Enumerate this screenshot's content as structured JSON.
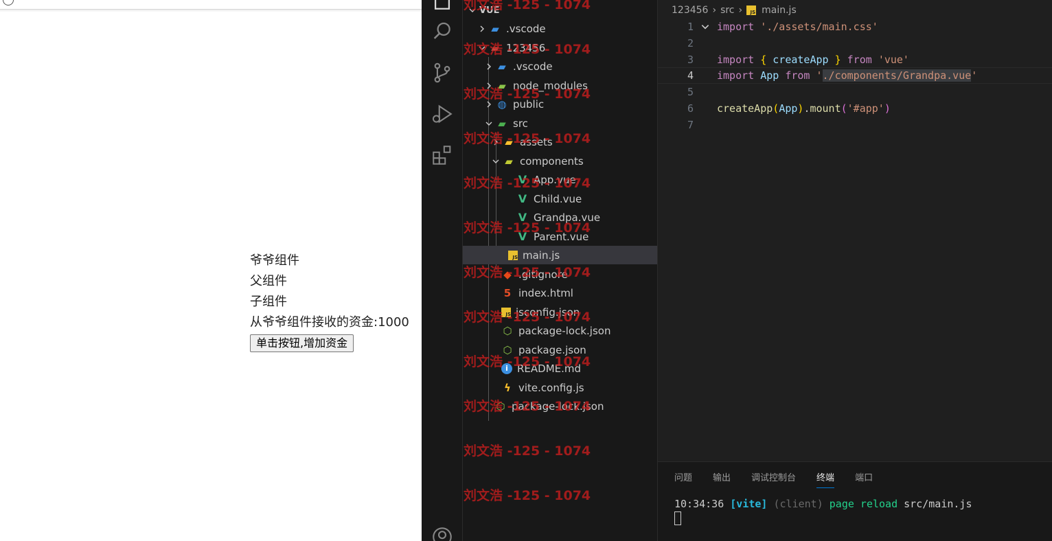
{
  "browser": {
    "lines": [
      "爷爷组件",
      "父组件",
      "子组件",
      "从爷爷组件接收的资金:1000"
    ],
    "button_label": "单击按钮,增加资金"
  },
  "activity_bar": {
    "icons": [
      "explorer-icon",
      "search-icon",
      "source-control-icon",
      "run-debug-icon",
      "extensions-icon",
      "account-icon"
    ]
  },
  "explorer": {
    "root": "VUE",
    "items": [
      {
        "label": ".vscode",
        "icon": "vscode-folder-icon",
        "color": "#3c8fe0"
      },
      {
        "label": "123456",
        "icon": "folder-open-icon",
        "color": "#c0574a"
      },
      {
        "label": ".vscode",
        "icon": "vscode-folder-icon",
        "color": "#3c8fe0"
      },
      {
        "label": "node_modules",
        "icon": "node-folder-icon",
        "color": "#8bc34a"
      },
      {
        "label": "public",
        "icon": "public-folder-icon",
        "color": "#3c8fe0"
      },
      {
        "label": "src",
        "icon": "src-folder-icon",
        "color": "#4caf50"
      },
      {
        "label": "assets",
        "icon": "assets-folder-icon",
        "color": "#fbc02d"
      },
      {
        "label": "components",
        "icon": "components-folder-icon",
        "color": "#c0ca33"
      },
      {
        "label": "App.vue",
        "icon": "vue-icon",
        "color": "#41b883"
      },
      {
        "label": "Child.vue",
        "icon": "vue-icon",
        "color": "#41b883"
      },
      {
        "label": "Grandpa.vue",
        "icon": "vue-icon",
        "color": "#41b883"
      },
      {
        "label": "Parent.vue",
        "icon": "vue-icon",
        "color": "#41b883"
      },
      {
        "label": "main.js",
        "icon": "js-icon",
        "color": "#e8c02f"
      },
      {
        "label": ".gitignore",
        "icon": "git-icon",
        "color": "#e64a19"
      },
      {
        "label": "index.html",
        "icon": "html-icon",
        "color": "#e44d26"
      },
      {
        "label": "jsconfig.json",
        "icon": "js-config-icon",
        "color": "#e8c02f"
      },
      {
        "label": "package-lock.json",
        "icon": "npm-icon",
        "color": "#8bc34a"
      },
      {
        "label": "package.json",
        "icon": "npm-icon",
        "color": "#8bc34a"
      },
      {
        "label": "README.md",
        "icon": "info-icon",
        "color": "#3c8fe0"
      },
      {
        "label": "vite.config.js",
        "icon": "vite-icon",
        "color": "#fbc02d"
      },
      {
        "label": "package-lock.json",
        "icon": "npm-icon",
        "color": "#8bc34a"
      }
    ]
  },
  "editor": {
    "breadcrumb": [
      "123456",
      "src",
      "main.js"
    ],
    "js_badge": "JS",
    "lines": [
      {
        "n": "1",
        "tokens": [
          [
            "kw",
            "import"
          ],
          [
            "punc",
            " "
          ],
          [
            "str",
            "'./assets/main.css'"
          ]
        ]
      },
      {
        "n": "2",
        "tokens": []
      },
      {
        "n": "3",
        "tokens": [
          [
            "kw",
            "import"
          ],
          [
            "punc",
            " "
          ],
          [
            "brace",
            "{"
          ],
          [
            "punc",
            " "
          ],
          [
            "var",
            "createApp"
          ],
          [
            "punc",
            " "
          ],
          [
            "brace",
            "}"
          ],
          [
            "punc",
            " "
          ],
          [
            "kw",
            "from"
          ],
          [
            "punc",
            " "
          ],
          [
            "str",
            "'vue'"
          ]
        ]
      },
      {
        "n": "4",
        "tokens": [
          [
            "kw",
            "import"
          ],
          [
            "punc",
            " "
          ],
          [
            "var",
            "App"
          ],
          [
            "punc",
            " "
          ],
          [
            "kw",
            "from"
          ],
          [
            "punc",
            " "
          ],
          [
            "str",
            "'"
          ],
          [
            "strhl",
            "./components/Grandpa.vue"
          ],
          [
            "str",
            "'"
          ]
        ]
      },
      {
        "n": "5",
        "tokens": []
      },
      {
        "n": "6",
        "tokens": [
          [
            "fn",
            "createApp"
          ],
          [
            "brace",
            "("
          ],
          [
            "var",
            "App"
          ],
          [
            "brace",
            ")"
          ],
          [
            "punc",
            "."
          ],
          [
            "fn",
            "mount"
          ],
          [
            "paren",
            "("
          ],
          [
            "str",
            "'#app'"
          ],
          [
            "paren",
            ")"
          ]
        ]
      },
      {
        "n": "7",
        "tokens": []
      }
    ]
  },
  "panel": {
    "tabs": [
      "问题",
      "输出",
      "调试控制台",
      "终端",
      "端口"
    ],
    "active_tab": "终端",
    "terminal": {
      "time": "10:34:36",
      "tag": "[vite]",
      "client": "(client)",
      "message": "page reload",
      "path": "src/main.js"
    }
  },
  "watermark": "刘文浩 -125 - 1074"
}
